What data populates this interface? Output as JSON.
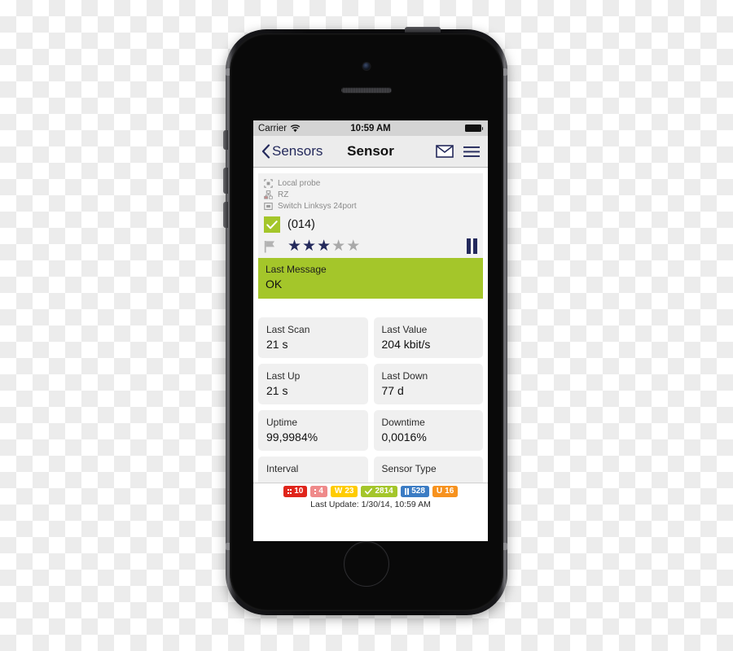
{
  "device": {
    "name": "iphone-5s-black",
    "home_button": "home-button",
    "camera": "front-camera",
    "speaker": "earpiece-speaker"
  },
  "status_bar": {
    "carrier": "Carrier",
    "wifi_icon": "wifi-icon",
    "time": "10:59 AM",
    "battery_icon": "battery-full-icon"
  },
  "nav_bar": {
    "back_icon": "chevron-left-icon",
    "back_label": "Sensors",
    "title": "Sensor",
    "mail_icon": "envelope-icon",
    "menu_icon": "hamburger-menu-icon"
  },
  "breadcrumb": [
    {
      "icon": "probe-icon",
      "label": "Local probe"
    },
    {
      "icon": "group-icon",
      "label": "RZ"
    },
    {
      "icon": "device-icon",
      "label": "Switch Linksys 24port"
    }
  ],
  "sensor": {
    "status_icon": "checkmark-icon",
    "status_color": "#a4c62a",
    "id": "(014)",
    "flag_icon": "flag-icon",
    "priority_stars_filled": 3,
    "priority_stars_total": 5,
    "star_on_color": "#242a5c",
    "star_off_color": "#a9a9a9",
    "pause_icon": "pause-icon"
  },
  "last_message": {
    "label": "Last Message",
    "value": "OK",
    "background": "#a4c62a"
  },
  "details": [
    {
      "label": "Last Scan",
      "value": "21 s"
    },
    {
      "label": "Last Value",
      "value": "204 kbit/s"
    },
    {
      "label": "Last Up",
      "value": "21 s"
    },
    {
      "label": "Last Down",
      "value": "77 d"
    },
    {
      "label": "Uptime",
      "value": "99,9984%"
    },
    {
      "label": "Downtime",
      "value": "0,0016%"
    },
    {
      "label": "Interval",
      "value": ""
    },
    {
      "label": "Sensor Type",
      "value": ""
    }
  ],
  "bottom_bar": {
    "badges": [
      {
        "icon": "down-sensors-icon",
        "count": "10",
        "color": "#e0251b"
      },
      {
        "icon": "warning-sensors-icon",
        "count": "4",
        "color": "#ef8a8a"
      },
      {
        "icon": "warning-icon",
        "letter": "W",
        "count": "23",
        "color": "#ffcc00"
      },
      {
        "icon": "ok-check-icon",
        "count": "2814",
        "color": "#a4c62a"
      },
      {
        "icon": "paused-icon",
        "count": "528",
        "color": "#3b7cc4"
      },
      {
        "icon": "unusual-icon",
        "letter": "U",
        "count": "16",
        "color": "#f7921e"
      }
    ],
    "last_update": "Last Update: 1/30/14, 10:59 AM"
  }
}
